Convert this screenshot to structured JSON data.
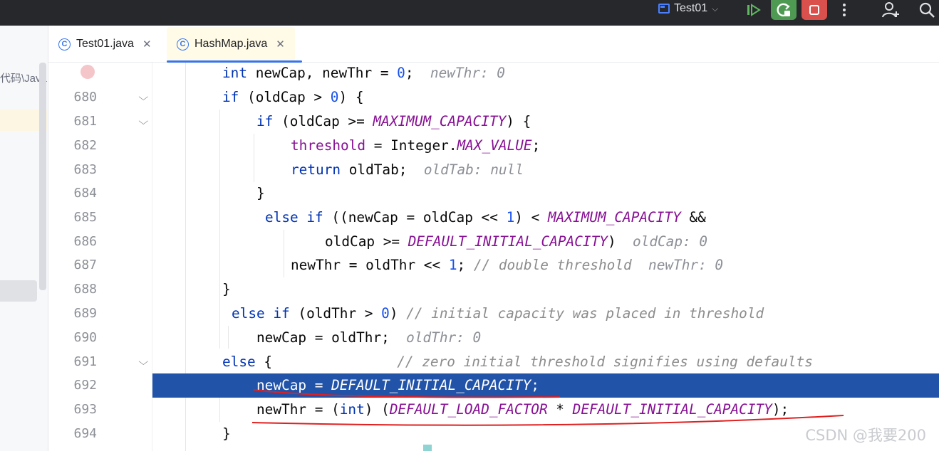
{
  "titlebar": {
    "run_config": "Test01",
    "run_config_icon": "run-config-icon",
    "chevron": "⌵",
    "buttons": [
      "resume-icon",
      "rerun-icon",
      "stop-icon",
      "more-icon",
      "add-user-icon",
      "search-icon"
    ]
  },
  "project_panel": {
    "path_fragment": "代码\\Java"
  },
  "tabs": [
    {
      "label": "Test01.java",
      "icon": "java-class-icon",
      "active": false
    },
    {
      "label": "HashMap.java",
      "icon": "java-class-icon",
      "active": true
    }
  ],
  "editor": {
    "lines": [
      {
        "num": "",
        "breakpoint": true
      },
      {
        "num": "680",
        "fold": true
      },
      {
        "num": "681",
        "fold": true
      },
      {
        "num": "682"
      },
      {
        "num": "683"
      },
      {
        "num": "684"
      },
      {
        "num": "685"
      },
      {
        "num": "686"
      },
      {
        "num": "687"
      },
      {
        "num": "688"
      },
      {
        "num": "689"
      },
      {
        "num": "690"
      },
      {
        "num": "691",
        "fold": true
      },
      {
        "num": "692",
        "execution_point": true
      },
      {
        "num": "693"
      },
      {
        "num": "694"
      }
    ],
    "code": {
      "l0": {
        "kw": "int",
        "a": " newCap, newThr = ",
        "n": "0",
        "b": ";",
        "hint": "newThr: 0"
      },
      "l1": {
        "kw": "if",
        "a": " (oldCap > ",
        "n": "0",
        "b": ") {"
      },
      "l2": {
        "kw": "if",
        "a": " (oldCap >= ",
        "c": "MAXIMUM_CAPACITY",
        "b": ") {"
      },
      "l3": {
        "f": "threshold",
        "a": " = Integer.",
        "c": "MAX_VALUE",
        "b": ";"
      },
      "l4": {
        "kw": "return",
        "a": " oldTab;",
        "hint": "oldTab: null"
      },
      "l5": {
        "a": "}"
      },
      "l6": {
        "kw": "else if",
        "a": " ((newCap = oldCap << ",
        "n": "1",
        "b": ") < ",
        "c": "MAXIMUM_CAPACITY",
        "d": " &&"
      },
      "l7": {
        "a": "oldCap >= ",
        "c": "DEFAULT_INITIAL_CAPACITY",
        "b": ")",
        "hint": "oldCap: 0"
      },
      "l8": {
        "a": "newThr = oldThr << ",
        "n": "1",
        "b": "; ",
        "cm": "// double threshold",
        "hint": "newThr: 0"
      },
      "l9": {
        "a": "}"
      },
      "l10": {
        "kw": "else if",
        "a": " (oldThr > ",
        "n": "0",
        "b": ") ",
        "cm": "// initial capacity was placed in threshold"
      },
      "l11": {
        "a": "newCap = oldThr;",
        "hint": "oldThr: 0"
      },
      "l12": {
        "kw": "else",
        "a": " {",
        "cm": "// zero initial threshold signifies using defaults"
      },
      "l13": {
        "a": "newCap = ",
        "c": "DEFAULT_INITIAL_CAPACITY",
        "b": ";"
      },
      "l14": {
        "a": "newThr = (",
        "kw": "int",
        "b": ") (",
        "c": "DEFAULT_LOAD_FACTOR",
        "d": " * ",
        "c2": "DEFAULT_INITIAL_CAPACITY",
        "e": ");"
      },
      "l15": {
        "a": "}"
      }
    }
  },
  "watermark": "CSDN @我要200",
  "colors": {
    "titlebar": "#27282c",
    "execution_line": "#2154a8",
    "keyword": "#0033b3",
    "constant": "#871094",
    "annotation_ink": "#e02020"
  }
}
